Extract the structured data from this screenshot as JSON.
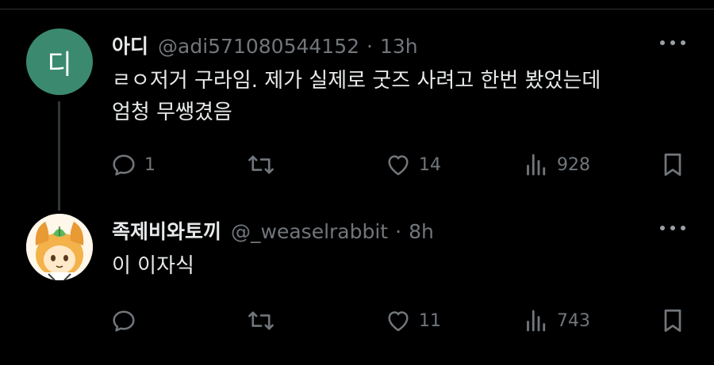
{
  "thread": [
    {
      "avatar": {
        "letter": "디",
        "color": "#3b8a70"
      },
      "display_name": "아디",
      "handle": "@adi5710805441​52",
      "time": "13h",
      "text_lines": [
        "ㄹㅇ저거 구라임. 제가 실제로 굿즈 사려고 한번 봤었는데",
        "엄청 무쌩겼음"
      ],
      "stats": {
        "replies": "1",
        "retweets": "",
        "likes": "14",
        "views": "928"
      }
    },
    {
      "avatar": {
        "letter": "",
        "color": "#f3b24a"
      },
      "display_name": "족제비와토끼",
      "handle": "@_weaselrabbit",
      "time": "8h",
      "text_lines": [
        "이 이자식"
      ],
      "stats": {
        "replies": "",
        "retweets": "",
        "likes": "11",
        "views": "743"
      }
    }
  ],
  "icons": {
    "reply": "reply-icon",
    "retweet": "retweet-icon",
    "like": "heart-icon",
    "views": "views-icon",
    "bookmark": "bookmark-icon",
    "more": "more-icon"
  },
  "separator": "·"
}
